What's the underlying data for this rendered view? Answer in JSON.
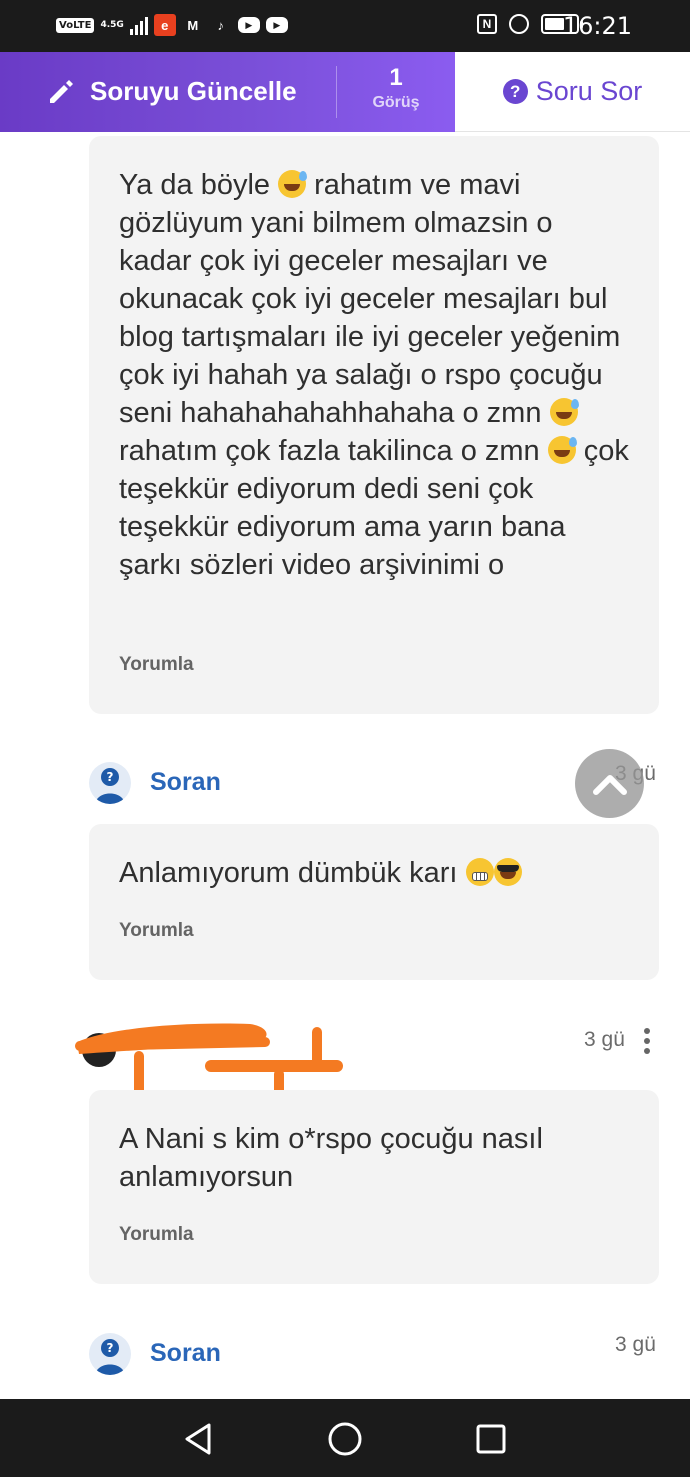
{
  "status_bar": {
    "volte": "VoLTE",
    "network": "4.5G",
    "time": "16:21",
    "battery_level": 0.55
  },
  "header": {
    "edit_label": "Soruyu Güncelle",
    "views_count": "1",
    "views_label": "Görüş",
    "ask_label": "Soru Sor"
  },
  "answers": [
    {
      "text_parts": [
        "Ya da böyle ",
        " rahatım ve mavi gözlüyum yani bilmem olmazsin o kadar çok iyi geceler mesajları ve okunacak çok iyi geceler mesajları bul blog tartışmaları ile iyi geceler yeğenim çok iyi hahah ya salağı o rspo çocuğu seni hahahahahahhahaha o zmn ",
        " rahatım çok fazla takilinca o zmn ",
        " çok teşekkür ediyorum dedi seni çok teşekkür ediyorum ama yarın bana şarkı sözleri video arşivinimi o"
      ],
      "comment_label": "Yorumla"
    },
    {
      "author": "Soran",
      "time": "3 gü",
      "text": "Anlamıyorum dümbük karı ",
      "comment_label": "Yorumla"
    },
    {
      "author_time": "3 gü",
      "text": "A Nani s kim o*rspo çocuğu nasıl anlamıyorsun",
      "comment_label": "Yorumla"
    },
    {
      "author": "Soran",
      "time": "3 gü"
    }
  ],
  "colors": {
    "header_gradient_start": "#6a3bc6",
    "header_gradient_end": "#8b5cf0",
    "ask_accent": "#6a46d1",
    "author_link": "#2a66b8",
    "redaction": "#f47a22"
  }
}
